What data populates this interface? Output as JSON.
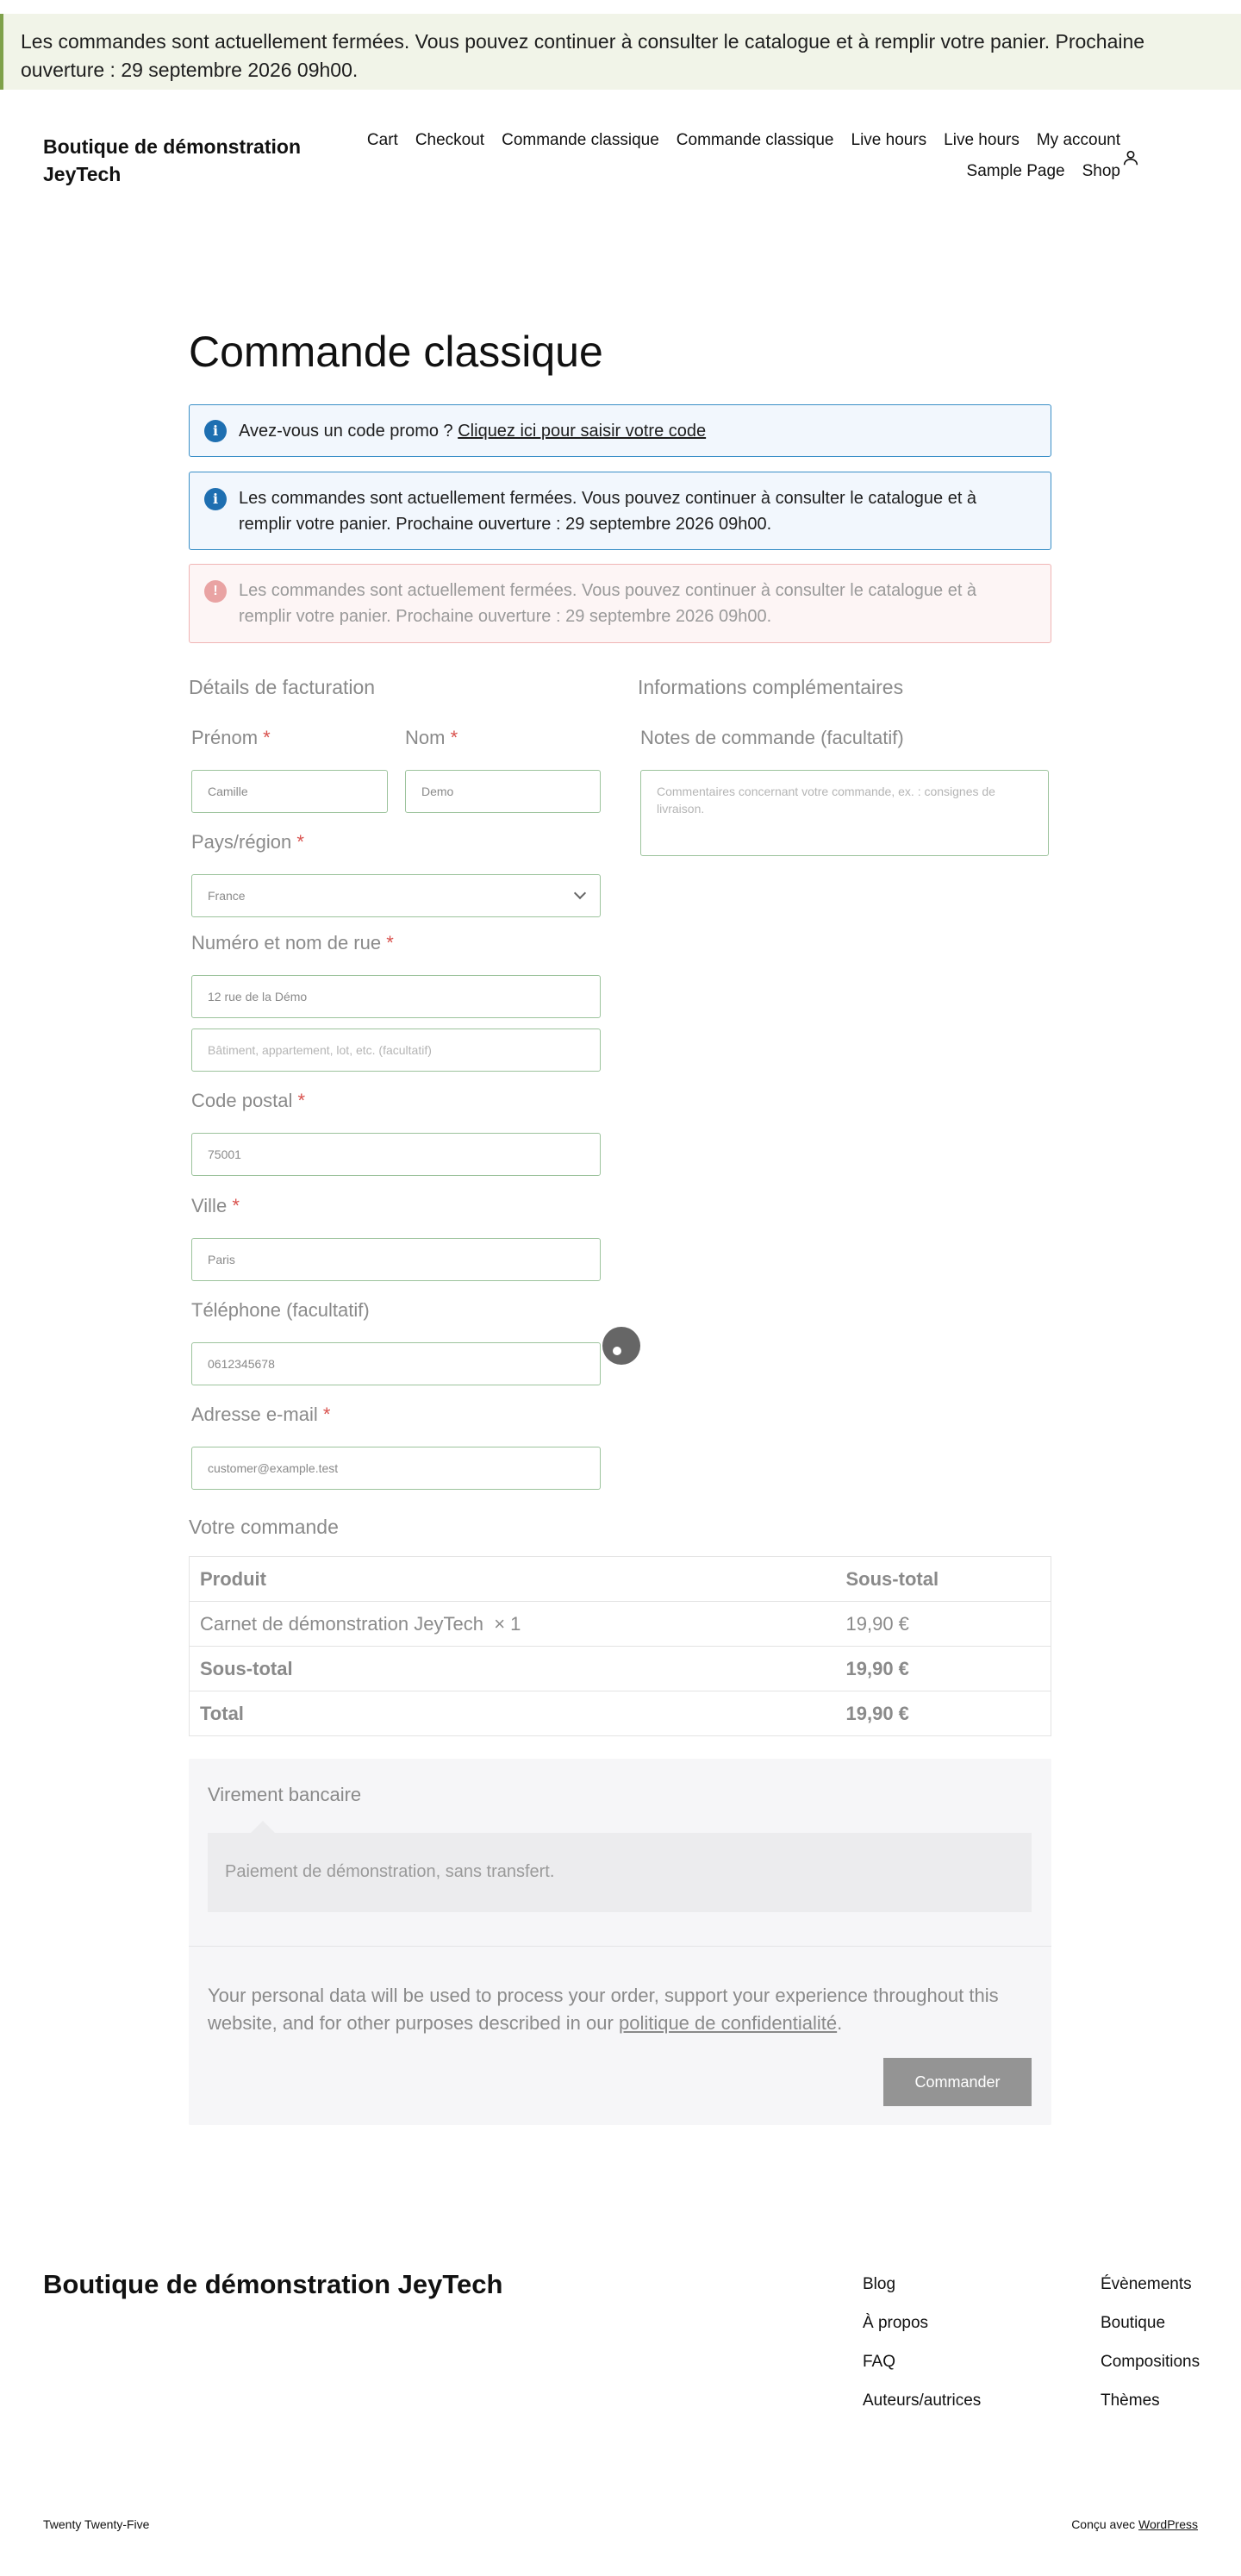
{
  "store_notice": "Les commandes sont actuellement fermées. Vous pouvez continuer à consulter le catalogue et à remplir votre panier. Prochaine ouverture : 29 septembre 2026 09h00.",
  "header": {
    "site_title": "Boutique de démonstration JeyTech",
    "nav": [
      "Cart",
      "Checkout",
      "Commande classique",
      "Commande classique",
      "Live hours",
      "Live hours",
      "My account",
      "Sample Page",
      "Shop"
    ],
    "account_icon": "user-icon"
  },
  "page_title": "Commande classique",
  "notices": {
    "promo_text": "Avez-vous un code promo ?",
    "promo_link": "Cliquez ici pour saisir votre code",
    "info_text": "Les commandes sont actuellement fermées. Vous pouvez continuer à consulter le catalogue et à remplir votre panier. Prochaine ouverture : 29 septembre 2026 09h00.",
    "error_text": "Les commandes sont actuellement fermées. Vous pouvez continuer à consulter le catalogue et à remplir votre panier. Prochaine ouverture : 29 septembre 2026 09h00.",
    "info_icon": "info-icon",
    "error_icon": "alert-icon"
  },
  "billing": {
    "title": "Détails de facturation",
    "required_mark": "*",
    "first_name": {
      "label": "Prénom",
      "value": "Camille"
    },
    "last_name": {
      "label": "Nom",
      "value": "Demo"
    },
    "country": {
      "label": "Pays/région",
      "value": "France"
    },
    "street": {
      "label": "Numéro et nom de rue",
      "value": "12 rue de la Démo",
      "placeholder2": "Bâtiment, appartement, lot, etc. (facultatif)"
    },
    "postcode": {
      "label": "Code postal",
      "value": "75001"
    },
    "city": {
      "label": "Ville",
      "value": "Paris"
    },
    "phone": {
      "label": "Téléphone (facultatif)",
      "value": "0612345678"
    },
    "email": {
      "label": "Adresse e-mail",
      "value": "customer@example.test"
    }
  },
  "additional": {
    "title": "Informations complémentaires",
    "notes_label": "Notes de commande (facultatif)",
    "notes_placeholder": "Commentaires concernant votre commande, ex. : consignes de livraison."
  },
  "order": {
    "title": "Votre commande",
    "col_product": "Produit",
    "col_subtotal": "Sous-total",
    "item_name": "Carnet de démonstration JeyTech",
    "item_qty": "× 1",
    "item_price": "19,90 €",
    "subtotal_label": "Sous-total",
    "subtotal_value": "19,90 €",
    "total_label": "Total",
    "total_value": "19,90 €"
  },
  "payment": {
    "method": "Virement bancaire",
    "description": "Paiement de démonstration, sans transfert.",
    "privacy_text": "Your personal data will be used to process your order, support your experience throughout this website, and for other purposes described in our",
    "privacy_link": "politique de confidentialité",
    "privacy_end": ".",
    "button": "Commander"
  },
  "footer": {
    "title": "Boutique de démonstration JeyTech",
    "col1": [
      "Blog",
      "À propos",
      "FAQ",
      "Auteurs/autrices"
    ],
    "col2": [
      "Évènements",
      "Boutique",
      "Compositions",
      "Thèmes"
    ],
    "theme": "Twenty Twenty-Five",
    "credit_prefix": "Conçu avec",
    "credit_link": "WordPress"
  },
  "colors": {
    "accent_green": "#7fa14a",
    "info_blue": "#1e6fb1",
    "error_pink": "#e9a3a3",
    "input_border": "#9cc39c"
  }
}
